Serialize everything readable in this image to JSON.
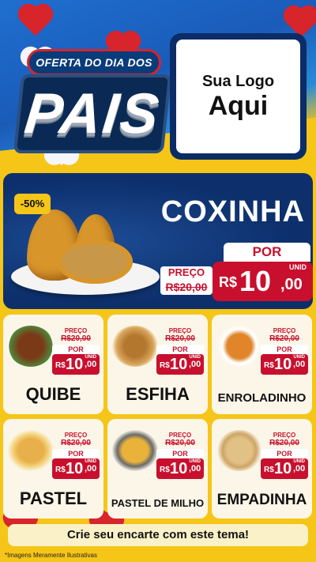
{
  "header": {
    "badge_top": "OFERTA DO DIA DOS",
    "badge_main": "PAIS",
    "logo_line1": "Sua Logo",
    "logo_line2": "Aqui"
  },
  "featured": {
    "discount": "-50%",
    "name": "COXINHA",
    "preco_label": "PREÇO",
    "old_price": "R$20,00",
    "por_label": "POR",
    "currency": "R$",
    "price_int": "10",
    "price_dec": ",00",
    "unit": "UNID"
  },
  "products": [
    {
      "name": "QUIBE",
      "preco_label": "PREÇO",
      "old_price": "R$20,00",
      "por_label": "POR",
      "currency": "R$",
      "price_int": "10",
      "price_dec": ",00",
      "unit": "UNID"
    },
    {
      "name": "ESFIHA",
      "preco_label": "PREÇO",
      "old_price": "R$20,00",
      "por_label": "POR",
      "currency": "R$",
      "price_int": "10",
      "price_dec": ",00",
      "unit": "UNID"
    },
    {
      "name": "ENROLADINHO",
      "preco_label": "PREÇO",
      "old_price": "R$20,00",
      "por_label": "POR",
      "currency": "R$",
      "price_int": "10",
      "price_dec": ",00",
      "unit": "UNID"
    },
    {
      "name": "PASTEL",
      "preco_label": "PREÇO",
      "old_price": "R$20,00",
      "por_label": "POR",
      "currency": "R$",
      "price_int": "10",
      "price_dec": ",00",
      "unit": "UNID"
    },
    {
      "name": "PASTEL DE MILHO",
      "preco_label": "PREÇO",
      "old_price": "R$20,00",
      "por_label": "POR",
      "currency": "R$",
      "price_int": "10",
      "price_dec": ",00",
      "unit": "UNID"
    },
    {
      "name": "EMPADINHA",
      "preco_label": "PREÇO",
      "old_price": "R$20,00",
      "por_label": "POR",
      "currency": "R$",
      "price_int": "10",
      "price_dec": ",00",
      "unit": "UNID"
    }
  ],
  "footer": {
    "cta": "Crie seu encarte com este tema!",
    "disclaimer": "*Imagens Meramente Ilustrativas"
  },
  "colors": {
    "blue": "#0d2f6b",
    "yellow": "#f5c518",
    "red": "#c8102e"
  }
}
